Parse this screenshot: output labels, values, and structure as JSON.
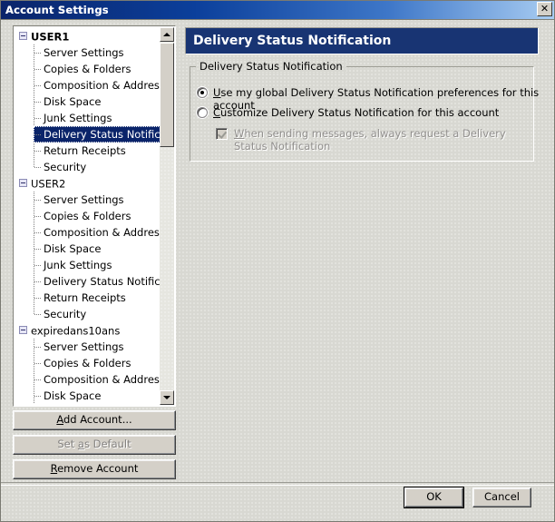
{
  "window": {
    "title": "Account Settings",
    "close_icon": "close-icon",
    "close_label": "✕"
  },
  "tree": {
    "nodes": [
      {
        "label": "USER1",
        "level": 0,
        "bold": true,
        "expanded": true
      },
      {
        "label": "Server Settings",
        "level": 1
      },
      {
        "label": "Copies & Folders",
        "level": 1
      },
      {
        "label": "Composition & Addressing",
        "level": 1
      },
      {
        "label": "Disk Space",
        "level": 1
      },
      {
        "label": "Junk Settings",
        "level": 1
      },
      {
        "label": "Delivery Status Notifica...",
        "level": 1,
        "selected": true
      },
      {
        "label": "Return Receipts",
        "level": 1
      },
      {
        "label": "Security",
        "level": 1,
        "last": true
      },
      {
        "label": "USER2",
        "level": 0,
        "bold": false,
        "expanded": true
      },
      {
        "label": "Server Settings",
        "level": 1
      },
      {
        "label": "Copies & Folders",
        "level": 1
      },
      {
        "label": "Composition & Addressing",
        "level": 1
      },
      {
        "label": "Disk Space",
        "level": 1
      },
      {
        "label": "Junk Settings",
        "level": 1
      },
      {
        "label": "Delivery Status Notifica...",
        "level": 1
      },
      {
        "label": "Return Receipts",
        "level": 1
      },
      {
        "label": "Security",
        "level": 1,
        "last": true
      },
      {
        "label": "expiredans10ans",
        "level": 0,
        "bold": false,
        "expanded": true
      },
      {
        "label": "Server Settings",
        "level": 1
      },
      {
        "label": "Copies & Folders",
        "level": 1
      },
      {
        "label": "Composition & Addressing",
        "level": 1
      },
      {
        "label": "Disk Space",
        "level": 1
      }
    ],
    "scrollbar": {
      "up_arrow": "scroll-up-icon",
      "down_arrow": "scroll-down-icon"
    }
  },
  "account_buttons": {
    "add": {
      "text": "Add Account...",
      "accel": "A",
      "disabled": false
    },
    "set_default": {
      "text": "Set as Default",
      "accel": "a",
      "disabled": true
    },
    "remove": {
      "text": "Remove Account",
      "accel": "R",
      "disabled": false
    }
  },
  "panel": {
    "header": "Delivery Status Notification",
    "groupbox_legend": "Delivery Status Notification",
    "options": [
      {
        "id": "use-global",
        "prefix": "",
        "accel": "U",
        "text": "se my global Delivery Status Notification preferences for this account",
        "checked": true
      },
      {
        "id": "customize",
        "prefix": "",
        "accel": "C",
        "text": "ustomize Delivery Status Notification for this account",
        "checked": false
      }
    ],
    "checkbox": {
      "accel": "W",
      "text": "hen sending messages, always request a Delivery Status Notification",
      "checked": true,
      "disabled": true
    }
  },
  "footer": {
    "ok": "OK",
    "cancel": "Cancel"
  },
  "colors": {
    "titlebar_start": "#0a246a",
    "titlebar_end": "#a9cdf2",
    "panel_header_bg": "#183473",
    "selection_bg": "#0a246a",
    "dialog_bg": "#d8d8d2",
    "button_face": "#d4d0c8"
  }
}
